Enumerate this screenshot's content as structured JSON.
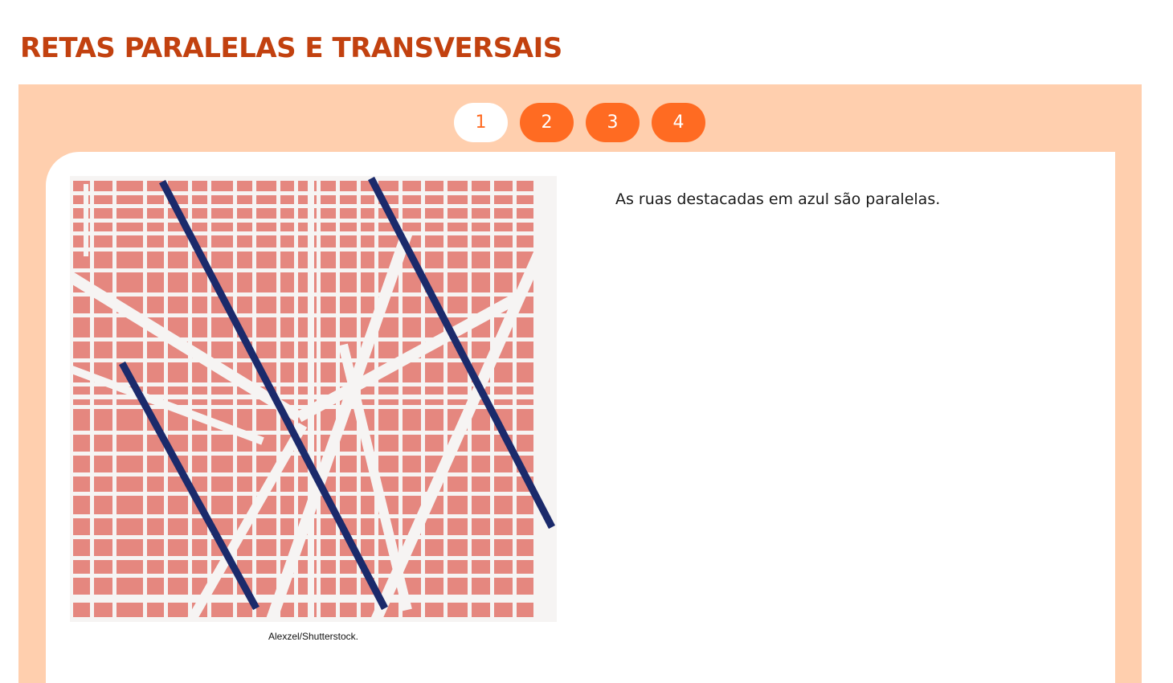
{
  "header": {
    "title": "RETAS PARALELAS E TRANSVERSAIS"
  },
  "pagination": {
    "pages": [
      {
        "label": "1",
        "active": true
      },
      {
        "label": "2",
        "active": false
      },
      {
        "label": "3",
        "active": false
      },
      {
        "label": "4",
        "active": false
      }
    ]
  },
  "figure": {
    "caption": "Alexzel/Shutterstock.",
    "image_subject": "city-street-map",
    "colors": {
      "block": "#e5877f",
      "street": "#f6f4f3",
      "highlight": "#1b2a6b"
    }
  },
  "content": {
    "text": "As ruas destacadas em azul são paralelas."
  },
  "theme": {
    "accent": "#ff6b22",
    "title": "#c2410f",
    "frame": "#ffcfae"
  }
}
